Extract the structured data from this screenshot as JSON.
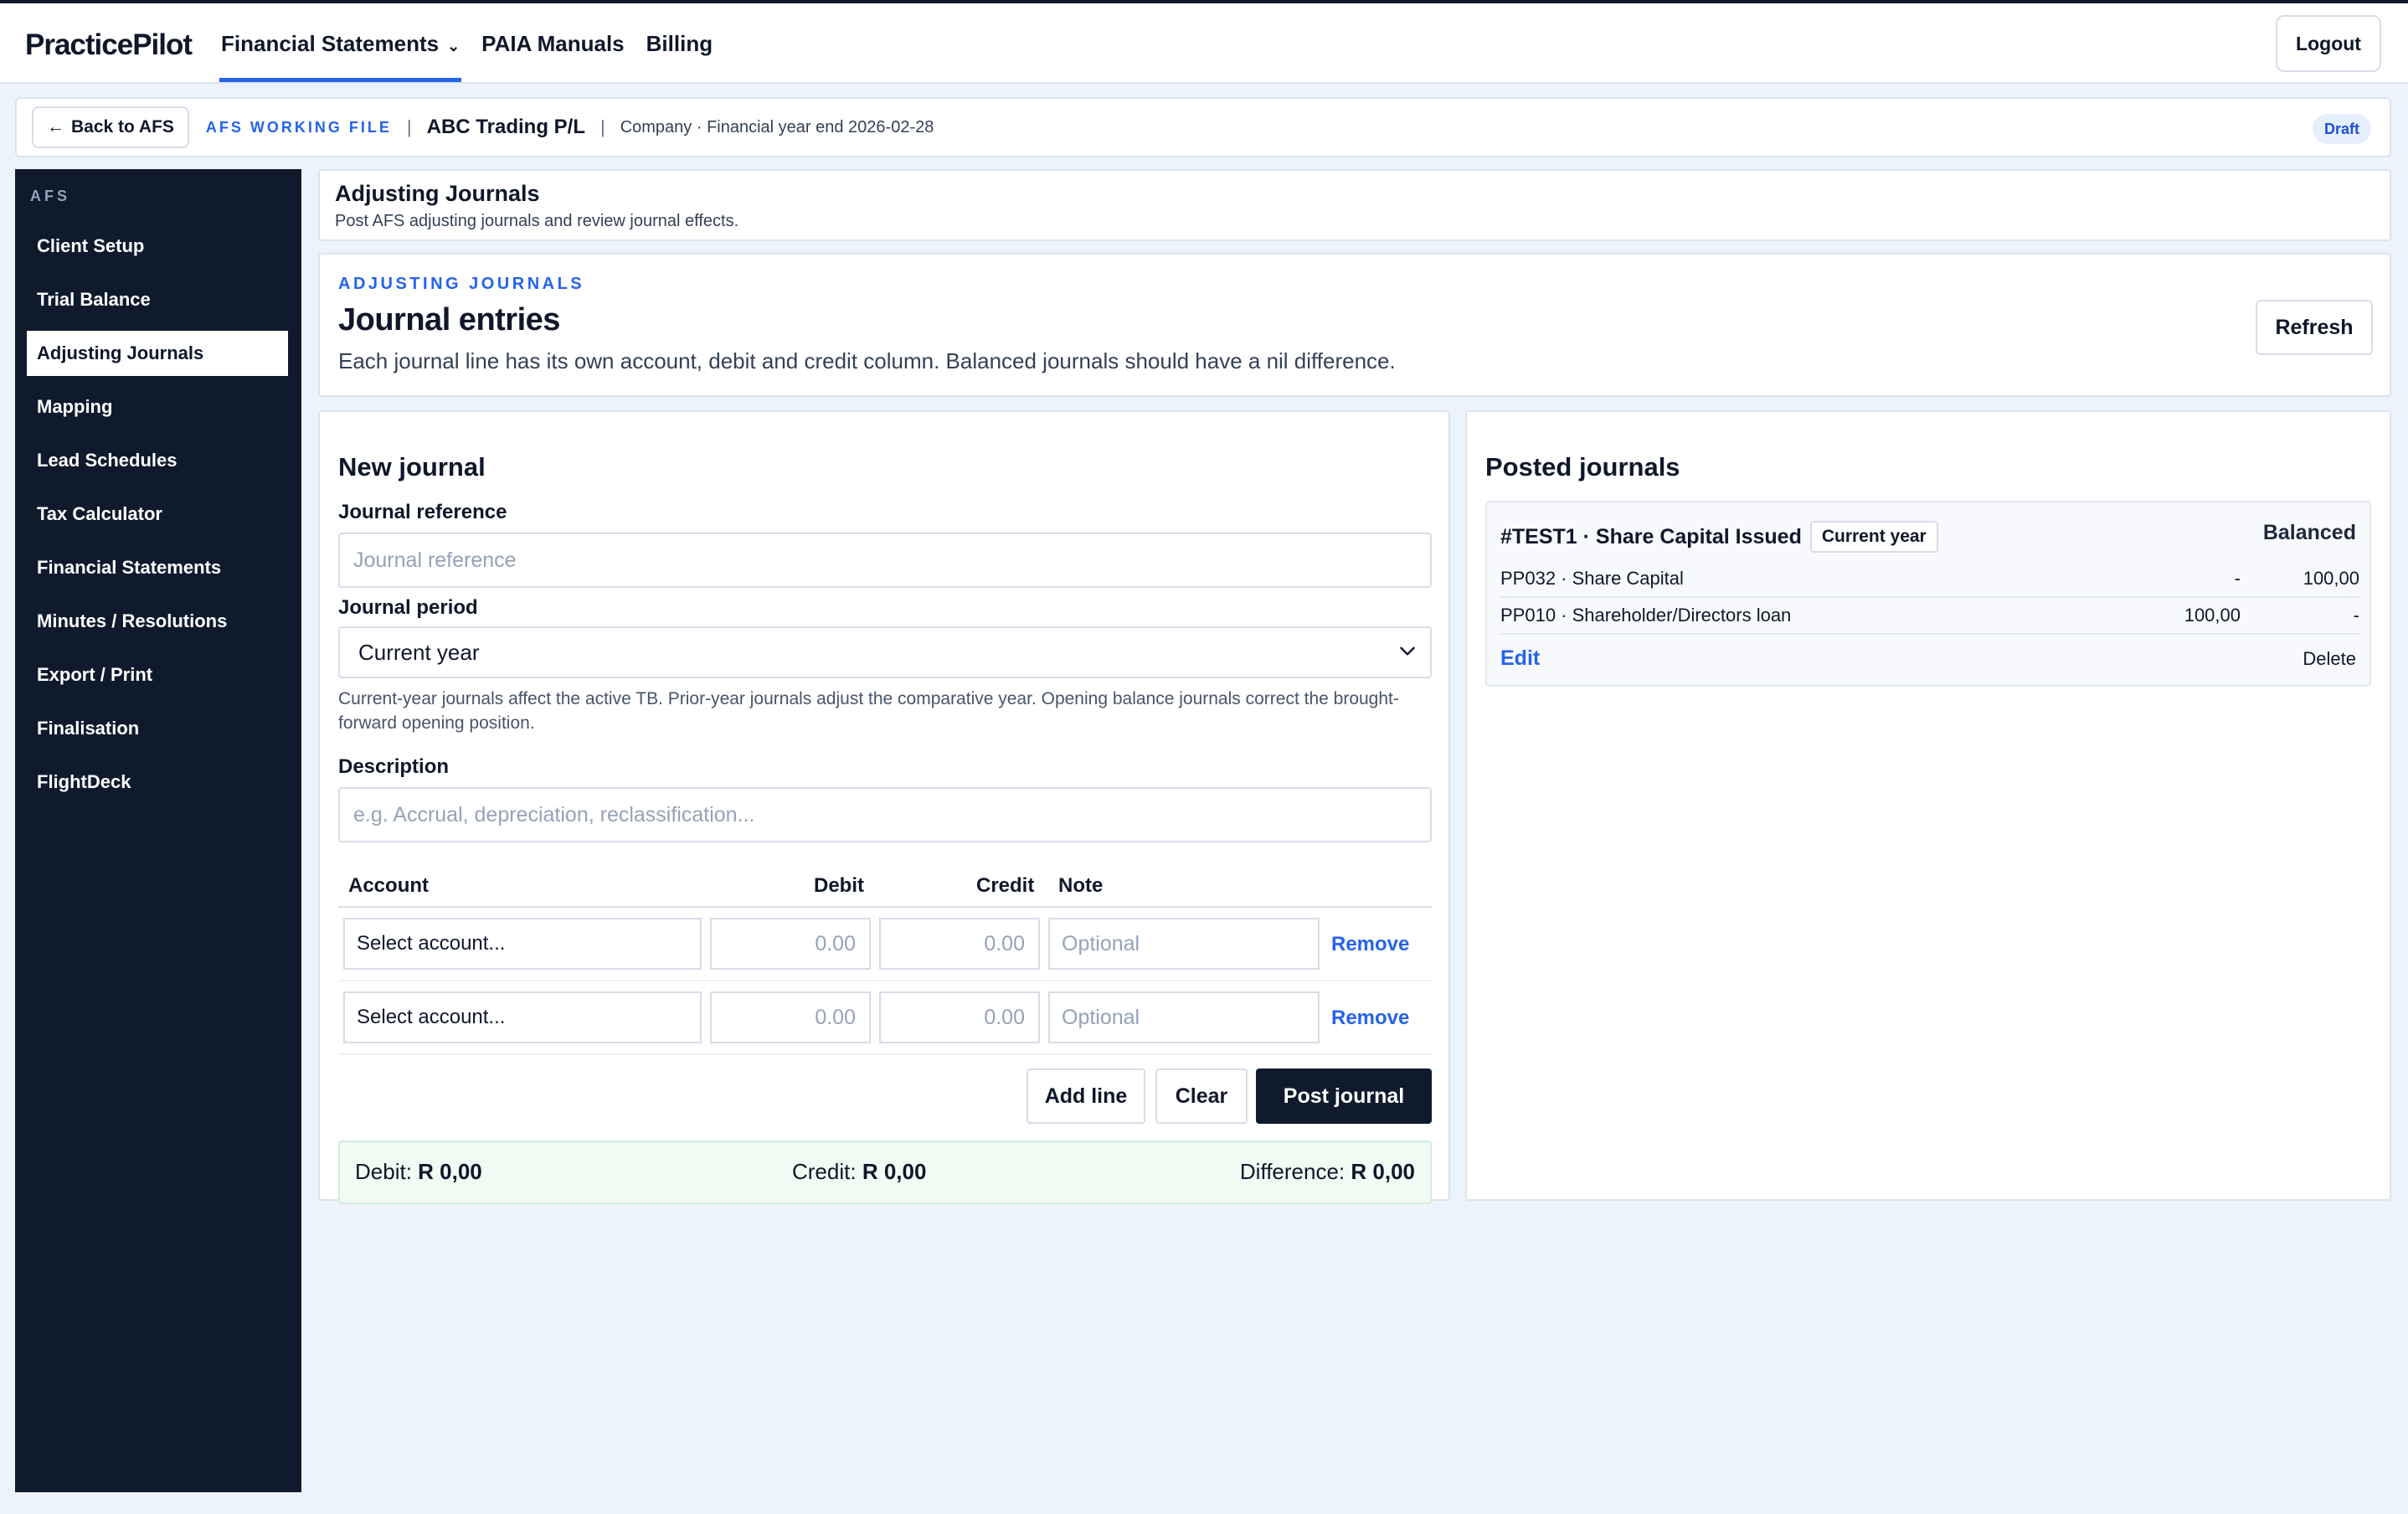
{
  "app": {
    "brand": "PracticePilot",
    "nav": [
      {
        "label": "Financial Statements",
        "active": true
      },
      {
        "label": "PAIA Manuals",
        "active": false
      },
      {
        "label": "Billing",
        "active": false
      }
    ],
    "logout_label": "Logout"
  },
  "afs_bar": {
    "back_label": "Back to AFS",
    "tag": "AFS WORKING FILE",
    "separator": "|",
    "company": "ABC Trading P/L",
    "meta": "Company · Financial year end 2026-02-28",
    "status": "Draft"
  },
  "sidebar": {
    "heading": "AFS",
    "items": [
      {
        "label": "Client Setup"
      },
      {
        "label": "Trial Balance"
      },
      {
        "label": "Adjusting Journals",
        "active": true
      },
      {
        "label": "Mapping"
      },
      {
        "label": "Lead Schedules"
      },
      {
        "label": "Tax Calculator"
      },
      {
        "label": "Financial Statements"
      },
      {
        "label": "Minutes / Resolutions"
      },
      {
        "label": "Export / Print"
      },
      {
        "label": "Finalisation"
      },
      {
        "label": "FlightDeck"
      }
    ]
  },
  "page_header": {
    "title": "Adjusting Journals",
    "subtitle": "Post AFS adjusting journals and review journal effects."
  },
  "journal_entries": {
    "eyebrow": "ADJUSTING JOURNALS",
    "title": "Journal entries",
    "description": "Each journal line has its own account, debit and credit column. Balanced journals should have a nil difference.",
    "refresh_label": "Refresh"
  },
  "new_journal": {
    "title": "New journal",
    "reference_label": "Journal reference",
    "reference_placeholder": "Journal reference",
    "period_label": "Journal period",
    "period_value": "Current year",
    "period_help": "Current-year journals affect the active TB. Prior-year journals adjust the comparative year. Opening balance journals correct the brought-forward opening position.",
    "description_label": "Description",
    "description_placeholder": "e.g. Accrual, depreciation, reclassification...",
    "columns": {
      "account": "Account",
      "debit": "Debit",
      "credit": "Credit",
      "note": "Note"
    },
    "lines": [
      {
        "account": "Select account...",
        "debit": "0.00",
        "credit": "0.00",
        "note": "Optional",
        "remove": "Remove"
      },
      {
        "account": "Select account...",
        "debit": "0.00",
        "credit": "0.00",
        "note": "Optional",
        "remove": "Remove"
      }
    ],
    "buttons": {
      "add_line": "Add line",
      "clear": "Clear",
      "post": "Post journal"
    },
    "totals": {
      "debit_label": "Debit:",
      "debit_value": "R 0,00",
      "credit_label": "Credit:",
      "credit_value": "R 0,00",
      "difference_label": "Difference:",
      "difference_value": "R 0,00"
    }
  },
  "posted_journals": {
    "title": "Posted journals",
    "items": [
      {
        "title": "#TEST1 · Share Capital Issued",
        "period": "Current year",
        "status": "Balanced",
        "lines": [
          {
            "account": "PP032 · Share Capital",
            "debit": "-",
            "credit": "100,00"
          },
          {
            "account": "PP010 · Shareholder/Directors loan",
            "debit": "100,00",
            "credit": "-"
          }
        ],
        "edit_label": "Edit",
        "delete_label": "Delete"
      }
    ]
  },
  "colors": {
    "accent": "#2563eb",
    "sidebar_bg": "#0f1b2d",
    "page_bg": "#edf3fa",
    "totals_bg": "#effbf3"
  }
}
